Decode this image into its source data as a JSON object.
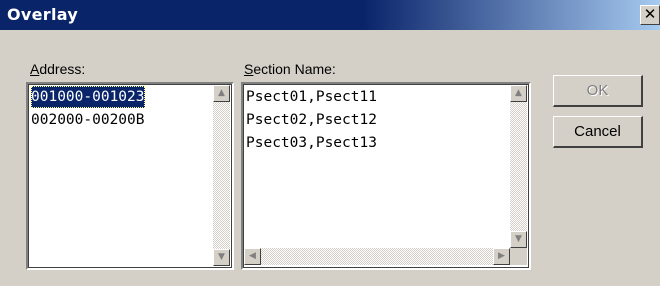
{
  "window": {
    "title": "Overlay",
    "close_glyph": "✕"
  },
  "address": {
    "label_accel": "A",
    "label_rest": "ddress:",
    "items": [
      "001000-001023",
      "002000-00200B"
    ],
    "selected_index": 0
  },
  "section": {
    "label_accel": "S",
    "label_rest": "ection Name:",
    "items": [
      "Psect01,Psect11",
      "Psect02,Psect12",
      "Psect03,Psect13"
    ]
  },
  "buttons": {
    "ok_label": "OK",
    "ok_enabled": false,
    "cancel_label": "Cancel"
  },
  "icons": {
    "scroll_up": "▲",
    "scroll_down": "▼",
    "scroll_left": "◀",
    "scroll_right": "▶"
  },
  "colors": {
    "title_active": "#0a246a",
    "selection": "#0a246a",
    "face": "#d4d0c8"
  }
}
